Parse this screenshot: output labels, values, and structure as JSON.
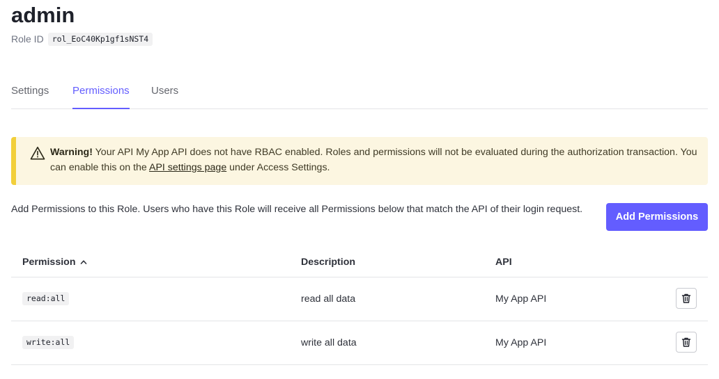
{
  "page": {
    "title": "admin",
    "role_id_label": "Role ID",
    "role_id_value": "rol_EoC40Kp1gf1sNST4"
  },
  "tabs": [
    {
      "label": "Settings",
      "active": false
    },
    {
      "label": "Permissions",
      "active": true
    },
    {
      "label": "Users",
      "active": false
    }
  ],
  "warning": {
    "icon": "warning-triangle-icon",
    "bold": "Warning!",
    "text_before_link": " Your API My App API does not have RBAC enabled. Roles and permissions will not be evaluated during the authorization transaction. You can enable this on the ",
    "link_text": "API settings page",
    "text_after_link": " under Access Settings.",
    "accent_color": "#f2cf3a",
    "background_color": "#fcf6e1"
  },
  "intro_text": "Add Permissions to this Role. Users who have this Role will receive all Permissions below that match the API of their login request.",
  "add_button_label": "Add Permissions",
  "accent_color": "#635dff",
  "table": {
    "headers": {
      "permission": "Permission",
      "description": "Description",
      "api": "API"
    },
    "sort": "ascending",
    "rows": [
      {
        "permission": "read:all",
        "description": "read all data",
        "api": "My App API"
      },
      {
        "permission": "write:all",
        "description": "write all data",
        "api": "My App API"
      }
    ]
  }
}
